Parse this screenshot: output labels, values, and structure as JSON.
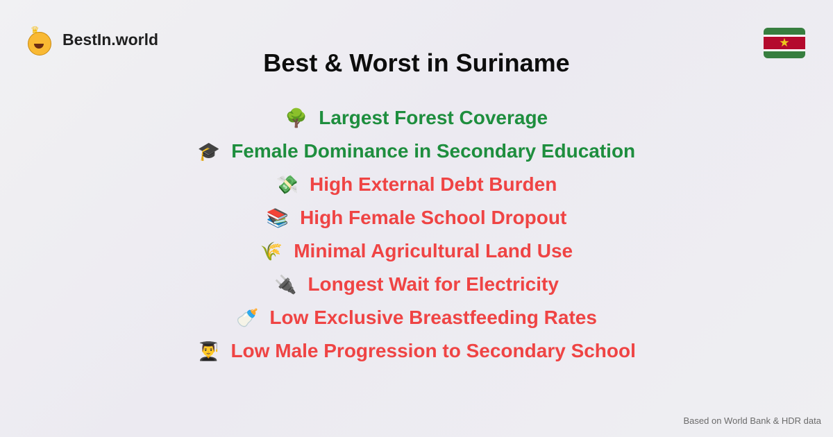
{
  "brand": {
    "name": "BestIn.world"
  },
  "title": "Best & Worst in Suriname",
  "colors": {
    "good": "#1e8e3e",
    "bad": "#ef4444"
  },
  "items": [
    {
      "icon": "🌳",
      "label": "Largest Forest Coverage",
      "type": "good"
    },
    {
      "icon": "🎓",
      "label": "Female Dominance in Secondary Education",
      "type": "good"
    },
    {
      "icon": "💸",
      "label": "High External Debt Burden",
      "type": "bad"
    },
    {
      "icon": "📚",
      "label": "High Female School Dropout",
      "type": "bad"
    },
    {
      "icon": "🌾",
      "label": "Minimal Agricultural Land Use",
      "type": "bad"
    },
    {
      "icon": "🔌",
      "label": "Longest Wait for Electricity",
      "type": "bad"
    },
    {
      "icon": "🍼",
      "label": "Low Exclusive Breastfeeding Rates",
      "type": "bad"
    },
    {
      "icon": "👨‍🎓",
      "label": "Low Male Progression to Secondary School",
      "type": "bad"
    }
  ],
  "footer": "Based on World Bank & HDR data"
}
